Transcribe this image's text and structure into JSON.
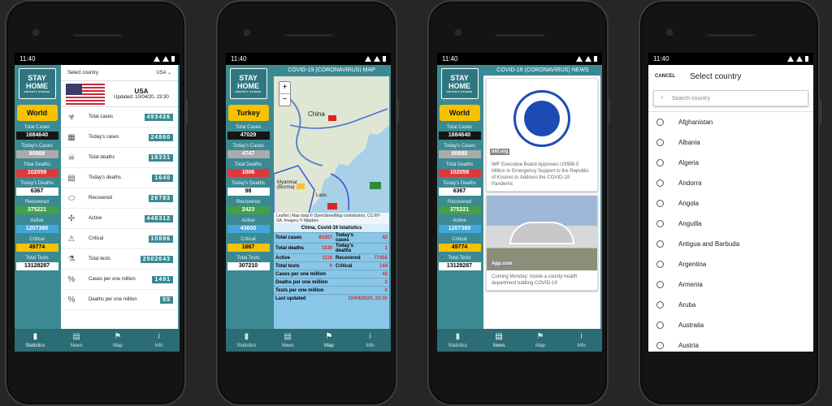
{
  "status": {
    "time": "11:40"
  },
  "nav": [
    "Statistics",
    "News",
    "Map",
    "Info"
  ],
  "phone1": {
    "logo_top": "STAY",
    "logo_bottom": "HOME",
    "logo_sub": "PROTECT OTHERS",
    "region_button": "World",
    "sidebar_stats": [
      {
        "label": "Total Cases",
        "value": "1684640",
        "style": "black"
      },
      {
        "label": "Today's Cases",
        "value": "80988",
        "style": "gray"
      },
      {
        "label": "Total Deaths",
        "value": "102059",
        "style": "red"
      },
      {
        "label": "Today's Deaths",
        "value": "6367",
        "style": "white"
      },
      {
        "label": "Recovered",
        "value": "375221",
        "style": "green"
      },
      {
        "label": "Active",
        "value": "1207360",
        "style": "blue"
      },
      {
        "label": "Critical",
        "value": "49774",
        "style": "yellow"
      },
      {
        "label": "Total Tests",
        "value": "13128287",
        "style": "white"
      }
    ],
    "select_label": "Select country",
    "select_value": "USA",
    "country_name": "USA",
    "updated": "Updated: 10/04/20, 23:30",
    "rows": [
      {
        "icon": "virus-icon",
        "glyph": "☣",
        "label": "Total cases",
        "value": "493426"
      },
      {
        "icon": "calendar-icon",
        "glyph": "▦",
        "label": "Today's cases",
        "value": "24860"
      },
      {
        "icon": "skull-icon",
        "glyph": "☠",
        "label": "Total deaths",
        "value": "18331"
      },
      {
        "icon": "calendar-day-icon",
        "glyph": "▤",
        "label": "Today's deaths",
        "value": "1640"
      },
      {
        "icon": "pill-icon",
        "glyph": "⬭",
        "label": "Recovered",
        "value": "26783"
      },
      {
        "icon": "bacteria-icon",
        "glyph": "✣",
        "label": "Active",
        "value": "448312"
      },
      {
        "icon": "warning-icon",
        "glyph": "⚠",
        "label": "Critical",
        "value": "10896"
      },
      {
        "icon": "flask-icon",
        "glyph": "⚗",
        "label": "Total tests",
        "value": "2502643"
      },
      {
        "icon": "percent-icon",
        "glyph": "%",
        "label": "Cases per one million",
        "value": "1491"
      },
      {
        "icon": "percent-icon",
        "glyph": "%",
        "label": "Deaths per one million",
        "value": "55"
      }
    ]
  },
  "phone2": {
    "logo_top": "STAY",
    "logo_bottom": "HOME",
    "logo_sub": "PROTECT OTHERS",
    "region_button": "Turkey",
    "sidebar_stats": [
      {
        "label": "Total Cases",
        "value": "47029",
        "style": "black"
      },
      {
        "label": "Today's Cases",
        "value": "4747",
        "style": "gray"
      },
      {
        "label": "Total Deaths",
        "value": "1006",
        "style": "red"
      },
      {
        "label": "Today's Deaths",
        "value": "98",
        "style": "white"
      },
      {
        "label": "Recovered",
        "value": "2423",
        "style": "green"
      },
      {
        "label": "Active",
        "value": "43600",
        "style": "blue"
      },
      {
        "label": "Critical",
        "value": "1667",
        "style": "yellow"
      },
      {
        "label": "Total Tests",
        "value": "307210",
        "style": "white"
      }
    ],
    "title": "COVID-19 (CORONAVIRUS) MAP",
    "map_labels": [
      "China",
      "Myanmar (Burma)",
      "Laos",
      "Vietnam"
    ],
    "zoom_in": "+",
    "zoom_out": "−",
    "attribution": "Leaflet | Map data © OpenStreetMap contributors, CC-BY-SA, Imagery © Mapbox",
    "table_title": "China, Covid-19 Istatistics",
    "table": [
      {
        "l1": "Total cases",
        "v1": "81907",
        "l2": "Today's cases",
        "v2": "42"
      },
      {
        "l1": "Total deaths",
        "v1": "3336",
        "l2": "Today's deaths",
        "v2": "1"
      },
      {
        "l1": "Active",
        "v1": "1116",
        "l2": "Recovered",
        "v2": "77455"
      },
      {
        "l1": "Total tests",
        "v1": "0",
        "l2": "Critical",
        "v2": "144"
      }
    ],
    "table_full": [
      {
        "label": "Cases per one million",
        "value": "42"
      },
      {
        "label": "Deaths per one million",
        "value": "2"
      },
      {
        "label": "Tests per one million",
        "value": "0"
      },
      {
        "label": "Last updated",
        "value": "10/04/2020, 23:30"
      }
    ]
  },
  "phone3": {
    "logo_top": "STAY",
    "logo_bottom": "HOME",
    "logo_sub": "PROTECT OTHERS",
    "region_button": "World",
    "sidebar_stats": [
      {
        "label": "Total Cases",
        "value": "1684640",
        "style": "black"
      },
      {
        "label": "Today's Cases",
        "value": "80988",
        "style": "gray"
      },
      {
        "label": "Total Deaths",
        "value": "102059",
        "style": "red"
      },
      {
        "label": "Today's Deaths",
        "value": "6367",
        "style": "white"
      },
      {
        "label": "Recovered",
        "value": "375221",
        "style": "green"
      },
      {
        "label": "Active",
        "value": "1207360",
        "style": "blue"
      },
      {
        "label": "Critical",
        "value": "49774",
        "style": "yellow"
      },
      {
        "label": "Total Tests",
        "value": "13128287",
        "style": "white"
      }
    ],
    "title": "COVID-19 (CORONAVIRUS) NEWS",
    "imf_text": "INTERNATIONAL MONETARY FUND",
    "news": [
      {
        "source": "imf.org",
        "text": "IMF Executive Board Approves US$56.5 Million in Emergency Support to the Republic of Kosovo to Address the COVID-19 Pandemic"
      },
      {
        "source": "App.com",
        "text": "Coming Monday: Inside a county health department battling COVID-19"
      }
    ]
  },
  "phone4": {
    "cancel": "CANCEL",
    "title": "Select country",
    "search_placeholder": "Search country",
    "countries": [
      "Afghanistan",
      "Albania",
      "Algeria",
      "Andorra",
      "Angola",
      "Anguilla",
      "Antigua and Barbuda",
      "Argentina",
      "Armenia",
      "Aruba",
      "Australia",
      "Austria"
    ]
  },
  "colors": {
    "teal": "#3b8a93",
    "yellow": "#f8c200",
    "red": "#e0383b"
  }
}
